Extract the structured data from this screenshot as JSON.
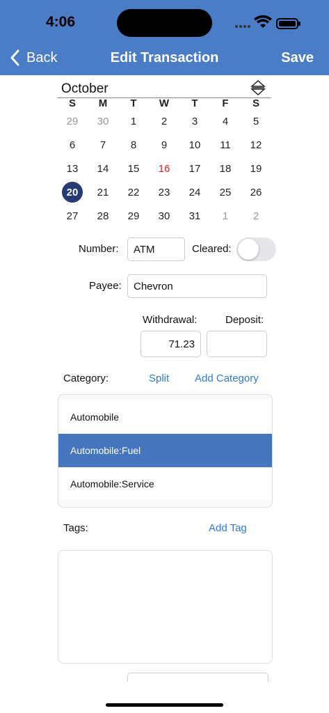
{
  "status": {
    "time": "4:06"
  },
  "nav": {
    "back_label": "Back",
    "title": "Edit Transaction",
    "save_label": "Save"
  },
  "calendar": {
    "month": "October",
    "weekdays": [
      "S",
      "M",
      "T",
      "W",
      "T",
      "F",
      "S"
    ],
    "days": [
      {
        "d": "29",
        "state": "muted"
      },
      {
        "d": "30",
        "state": "muted"
      },
      {
        "d": "1"
      },
      {
        "d": "2"
      },
      {
        "d": "3"
      },
      {
        "d": "4"
      },
      {
        "d": "5"
      },
      {
        "d": "6"
      },
      {
        "d": "7"
      },
      {
        "d": "8"
      },
      {
        "d": "9"
      },
      {
        "d": "10"
      },
      {
        "d": "11"
      },
      {
        "d": "12"
      },
      {
        "d": "13"
      },
      {
        "d": "14"
      },
      {
        "d": "15"
      },
      {
        "d": "16",
        "state": "today"
      },
      {
        "d": "17"
      },
      {
        "d": "18"
      },
      {
        "d": "19"
      },
      {
        "d": "20",
        "state": "selected"
      },
      {
        "d": "21"
      },
      {
        "d": "22"
      },
      {
        "d": "23"
      },
      {
        "d": "24"
      },
      {
        "d": "25"
      },
      {
        "d": "26"
      },
      {
        "d": "27"
      },
      {
        "d": "28"
      },
      {
        "d": "29"
      },
      {
        "d": "30"
      },
      {
        "d": "31"
      },
      {
        "d": "1",
        "state": "muted"
      },
      {
        "d": "2",
        "state": "muted"
      }
    ]
  },
  "form": {
    "number_label": "Number:",
    "number_value": "ATM",
    "cleared_label": "Cleared:",
    "cleared": false,
    "payee_label": "Payee:",
    "payee_value": "Chevron",
    "withdrawal_label": "Withdrawal:",
    "withdrawal_value": "71.23",
    "deposit_label": "Deposit:",
    "deposit_value": "",
    "category_label": "Category:",
    "split_label": "Split",
    "add_category_label": "Add Category",
    "tags_label": "Tags:",
    "add_tag_label": "Add Tag"
  },
  "categories": [
    {
      "name": "Automobile",
      "selected": false
    },
    {
      "name": "Automobile:Fuel",
      "selected": true
    },
    {
      "name": "Automobile:Service",
      "selected": false
    }
  ],
  "colors": {
    "header": "#4b7cc6",
    "accent": "#2c7bd6",
    "selected_row": "#4576bd",
    "selected_day": "#263a73",
    "today": "#e02020"
  }
}
